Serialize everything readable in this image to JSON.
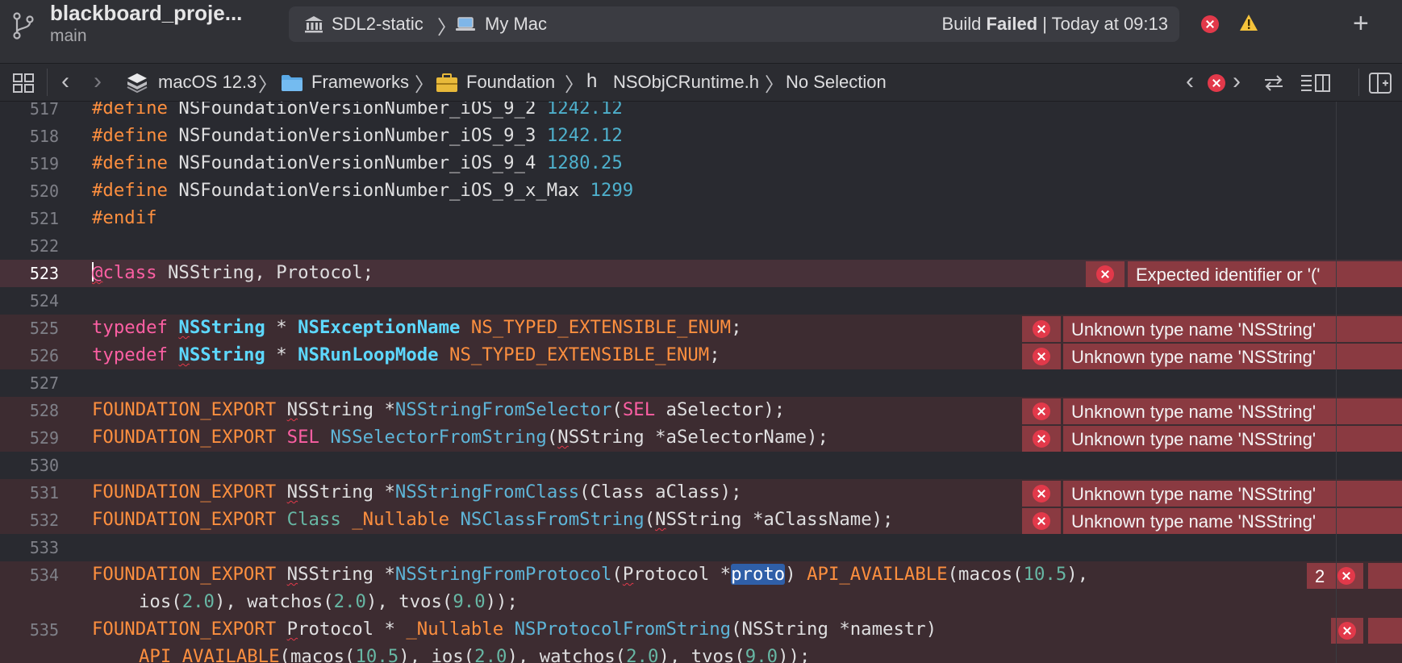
{
  "titlebar": {
    "project": "blackboard_proje...",
    "branch": "main",
    "scheme": "SDL2-static",
    "destination": "My Mac",
    "status_prefix": "Build ",
    "status_strong": "Failed",
    "status_suffix": " | Today at 09:13"
  },
  "jumpbar": {
    "sdk": "macOS 12.3",
    "folder": "Frameworks",
    "framework": "Foundation",
    "file_glyph": "h",
    "file": "NSObjCRuntime.h",
    "selection": "No Selection"
  },
  "editor": {
    "issue_badge_count": "2",
    "lines": [
      {
        "n": "517"
      },
      {
        "n": "518"
      },
      {
        "n": "519"
      },
      {
        "n": "520"
      },
      {
        "n": "521"
      },
      {
        "n": "522"
      },
      {
        "n": "523"
      },
      {
        "n": "524"
      },
      {
        "n": "525"
      },
      {
        "n": "526"
      },
      {
        "n": "527"
      },
      {
        "n": "528"
      },
      {
        "n": "529"
      },
      {
        "n": "530"
      },
      {
        "n": "531"
      },
      {
        "n": "532"
      },
      {
        "n": "533"
      },
      {
        "n": "534"
      },
      {
        "n": "535"
      }
    ],
    "errors": {
      "e523": "Expected identifier or '('",
      "e525": "Unknown type name 'NSString'",
      "e526": "Unknown type name 'NSString'",
      "e528": "Unknown type name 'NSString'",
      "e529": "Unknown type name 'NSString'",
      "e531": "Unknown type name 'NSString'",
      "e532": "Unknown type name 'NSString'"
    }
  },
  "colors": {
    "background": "#292a30",
    "error_accent": "#e2394a",
    "error_banner": "#8a3a41",
    "preprocessor": "#fd8f3f",
    "keyword": "#fc5fa3",
    "number": "#4eb0cc",
    "type": "#5dd8ff"
  },
  "icons": [
    "branch-icon",
    "scheme-icon",
    "mac-icon",
    "error-icon",
    "warning-icon",
    "add-icon",
    "grid-icon",
    "chevron-left-icon",
    "chevron-right-icon",
    "sdk-icon",
    "folder-icon",
    "toolbox-icon",
    "swap-icon",
    "inspector-icon",
    "split-editor-icon"
  ]
}
